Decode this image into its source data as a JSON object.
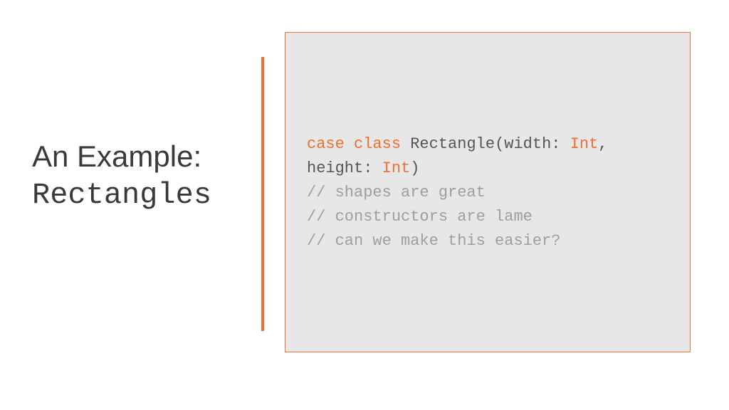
{
  "title": {
    "line1": "An Example:",
    "line2": "Rectangles"
  },
  "code": {
    "kw_case": "case",
    "kw_class": "class",
    "class_name": "Rectangle",
    "param1_name": "width",
    "param1_type": "Int",
    "param2_name": "height",
    "param2_type": "Int",
    "comment1": "// shapes are great",
    "comment2": "// constructors are lame",
    "comment3": "// can we make this easier?"
  }
}
